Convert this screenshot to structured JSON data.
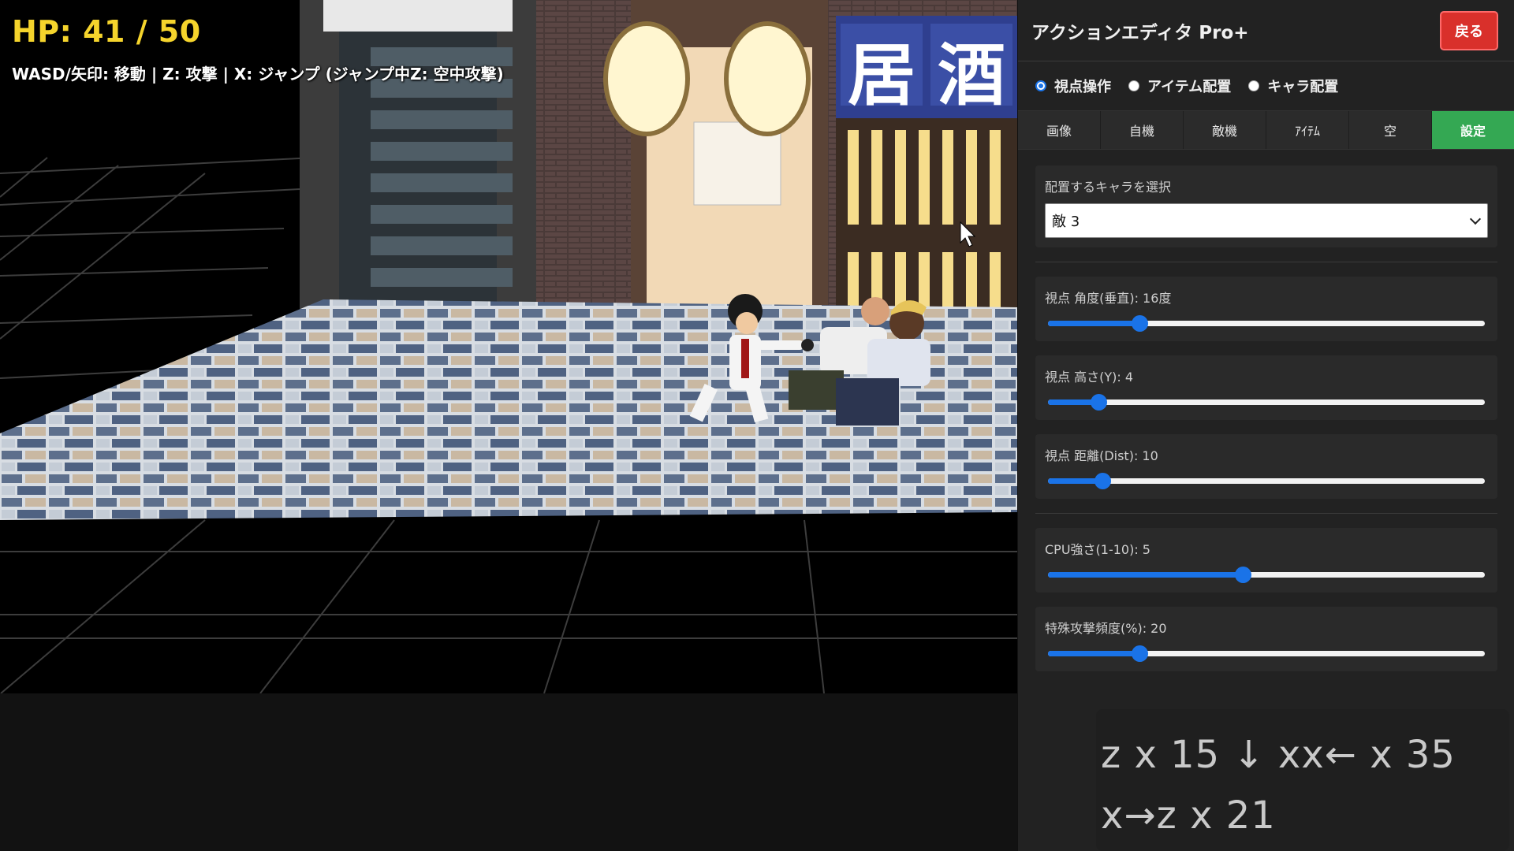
{
  "hud": {
    "hp": "HP: 41 / 50",
    "controls": "WASD/矢印: 移動 | Z: 攻撃 | X: ジャンプ (ジャンプ中Z: 空中攻撃)"
  },
  "scene": {
    "signs": [
      "居",
      "酒"
    ]
  },
  "panel": {
    "title": "アクションエディタ Pro+",
    "back_label": "戻る",
    "modes": [
      {
        "label": "視点操作",
        "selected": true
      },
      {
        "label": "アイテム配置",
        "selected": false
      },
      {
        "label": "キャラ配置",
        "selected": false
      }
    ],
    "tabs": [
      {
        "label": "画像",
        "active": false
      },
      {
        "label": "自機",
        "active": false
      },
      {
        "label": "敵機",
        "active": false
      },
      {
        "label": "ｱｲﾃﾑ",
        "active": false
      },
      {
        "label": "空",
        "active": false
      },
      {
        "label": "設定",
        "active": true
      }
    ],
    "char_select": {
      "label": "配置するキャラを選択",
      "value": "敵 3"
    },
    "sliders": [
      {
        "label": "視点 角度(垂直): 16度",
        "fraction": 0.21
      },
      {
        "label": "視点 高さ(Y): 4",
        "fraction": 0.115
      },
      {
        "label": "視点 距離(Dist): 10",
        "fraction": 0.125
      },
      {
        "label": "CPU強さ(1-10): 5",
        "fraction": 0.445
      },
      {
        "label": "特殊攻撃頻度(%): 20",
        "fraction": 0.21
      }
    ]
  },
  "combo": {
    "line1": "z x 15  ↓ xx← x 35",
    "line2": "x→z x 21"
  },
  "colors": {
    "hp": "#f5d42c",
    "accent": "#1a73e8",
    "active_tab": "#34a853",
    "back_button": "#d9302b"
  }
}
